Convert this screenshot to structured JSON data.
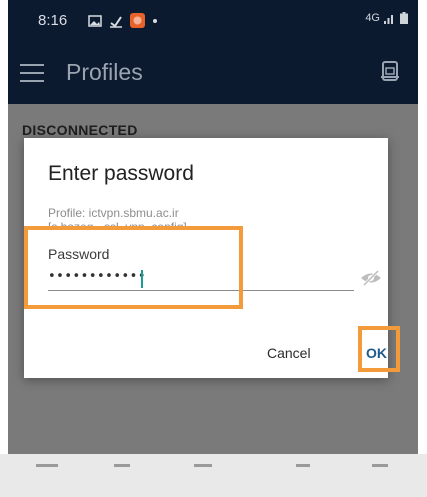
{
  "status_bar": {
    "time": "8:16",
    "network": "4G",
    "icons": [
      "gallery-icon",
      "download-icon",
      "app-notification-icon",
      "dot-icon",
      "signal-icon",
      "battery-icon"
    ]
  },
  "app_bar": {
    "title": "Profiles",
    "icons": [
      "menu-icon",
      "import-profile-icon"
    ]
  },
  "background": {
    "status": "DISCONNECTED"
  },
  "dialog": {
    "title": "Enter password",
    "profile_line": "Profile: ictvpn.sbmu.ac.ir",
    "profile_line2": "[s.hazeq - ssl_vpn_config]",
    "password_label": "Password",
    "password_value": "••••••••••••",
    "cancel_label": "Cancel",
    "ok_label": "OK"
  },
  "colors": {
    "app_bar": "#0c1a30",
    "dim_overlay": "#7a7a7a",
    "accent_caret": "#1a9e8f",
    "ok_text": "#1d5c8a",
    "highlight": "#f39a3a"
  }
}
